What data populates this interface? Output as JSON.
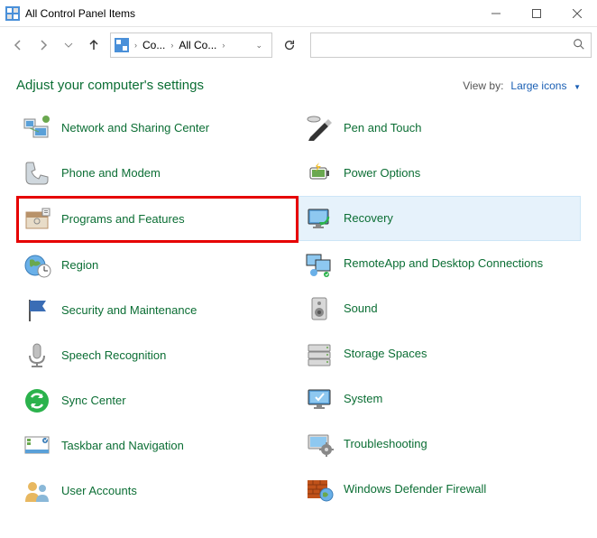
{
  "window": {
    "title": "All Control Panel Items"
  },
  "address_bar": {
    "seg1": "Co...",
    "seg2": "All Co..."
  },
  "header": {
    "title": "Adjust your computer's settings",
    "viewby_label": "View by:",
    "viewby_value": "Large icons"
  },
  "items_left": [
    {
      "label": "Network and Sharing Center",
      "name": "network-sharing-center",
      "highlight": false
    },
    {
      "label": "Phone and Modem",
      "name": "phone-and-modem",
      "highlight": false
    },
    {
      "label": "Programs and Features",
      "name": "programs-and-features",
      "highlight": true
    },
    {
      "label": "Region",
      "name": "region",
      "highlight": false
    },
    {
      "label": "Security and Maintenance",
      "name": "security-and-maintenance",
      "highlight": false
    },
    {
      "label": "Speech Recognition",
      "name": "speech-recognition",
      "highlight": false
    },
    {
      "label": "Sync Center",
      "name": "sync-center",
      "highlight": false
    },
    {
      "label": "Taskbar and Navigation",
      "name": "taskbar-and-navigation",
      "highlight": false
    },
    {
      "label": "User Accounts",
      "name": "user-accounts",
      "highlight": false
    }
  ],
  "items_right": [
    {
      "label": "Pen and Touch",
      "name": "pen-and-touch",
      "hover": false
    },
    {
      "label": "Power Options",
      "name": "power-options",
      "hover": false
    },
    {
      "label": "Recovery",
      "name": "recovery",
      "hover": true
    },
    {
      "label": "RemoteApp and Desktop Connections",
      "name": "remoteapp-desktop-connections",
      "hover": false
    },
    {
      "label": "Sound",
      "name": "sound",
      "hover": false
    },
    {
      "label": "Storage Spaces",
      "name": "storage-spaces",
      "hover": false
    },
    {
      "label": "System",
      "name": "system",
      "hover": false
    },
    {
      "label": "Troubleshooting",
      "name": "troubleshooting",
      "hover": false
    },
    {
      "label": "Windows Defender Firewall",
      "name": "windows-defender-firewall",
      "hover": false
    }
  ],
  "icons": {
    "network-sharing-center": {
      "bg": "#f0f0f0",
      "fg": "#5aa0d8",
      "shape": "computers"
    },
    "phone-and-modem": {
      "bg": "#f5f5f5",
      "fg": "#8a9ba8",
      "shape": "phone"
    },
    "programs-and-features": {
      "bg": "#f0f0f0",
      "fg": "#b8926a",
      "shape": "box"
    },
    "region": {
      "bg": "#fff",
      "fg": "#5aa0d8",
      "shape": "globe-clock"
    },
    "security-and-maintenance": {
      "bg": "#fff",
      "fg": "#3a6db5",
      "shape": "flag"
    },
    "speech-recognition": {
      "bg": "#fff",
      "fg": "#888",
      "shape": "microphone"
    },
    "sync-center": {
      "bg": "#fff",
      "fg": "#2bb24c",
      "shape": "sync"
    },
    "taskbar-and-navigation": {
      "bg": "#fff",
      "fg": "#5aa0d8",
      "shape": "taskbar"
    },
    "user-accounts": {
      "bg": "#fff",
      "fg": "#e8b860",
      "shape": "users"
    },
    "pen-and-touch": {
      "bg": "#fff",
      "fg": "#333",
      "shape": "pen"
    },
    "power-options": {
      "bg": "#fff",
      "fg": "#6aa84f",
      "shape": "battery"
    },
    "recovery": {
      "bg": "#fff",
      "fg": "#5aa0d8",
      "shape": "monitor-arrow"
    },
    "remoteapp-desktop-connections": {
      "bg": "#fff",
      "fg": "#5aa0d8",
      "shape": "two-monitors"
    },
    "sound": {
      "bg": "#fff",
      "fg": "#888",
      "shape": "speaker"
    },
    "storage-spaces": {
      "bg": "#fff",
      "fg": "#888",
      "shape": "drives"
    },
    "system": {
      "bg": "#fff",
      "fg": "#5aa0d8",
      "shape": "monitor-check"
    },
    "troubleshooting": {
      "bg": "#fff",
      "fg": "#888",
      "shape": "monitor-gear"
    },
    "windows-defender-firewall": {
      "bg": "#fff",
      "fg": "#c0521a",
      "shape": "brick-globe"
    }
  }
}
